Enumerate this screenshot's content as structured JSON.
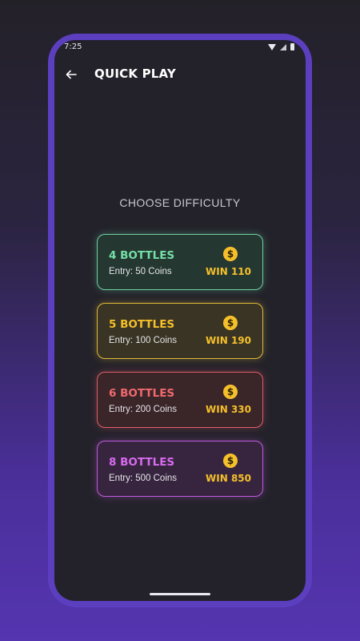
{
  "status_bar": {
    "time": "7:25"
  },
  "header": {
    "title": "QUICK PLAY",
    "back_icon": "arrow-left-icon"
  },
  "main": {
    "choose_label": "CHOOSE DIFFICULTY",
    "levels": [
      {
        "title": "4 BOTTLES",
        "entry": "Entry: 50 Coins",
        "win": "WIN 110",
        "coin_symbol": "$",
        "color": "#74e0a8"
      },
      {
        "title": "5 BOTTLES",
        "entry": "Entry: 100 Coins",
        "win": "WIN 190",
        "coin_symbol": "$",
        "color": "#f5c02b"
      },
      {
        "title": "6 BOTTLES",
        "entry": "Entry: 200 Coins",
        "win": "WIN 330",
        "coin_symbol": "$",
        "color": "#f06a6e"
      },
      {
        "title": "8 BOTTLES",
        "entry": "Entry: 500 Coins",
        "win": "WIN 850",
        "coin_symbol": "$",
        "color": "#d86bf0"
      }
    ]
  },
  "colors": {
    "accent_gold": "#f5c02b",
    "frame_purple": "#5b3fbf",
    "screen_bg": "#23222a"
  }
}
